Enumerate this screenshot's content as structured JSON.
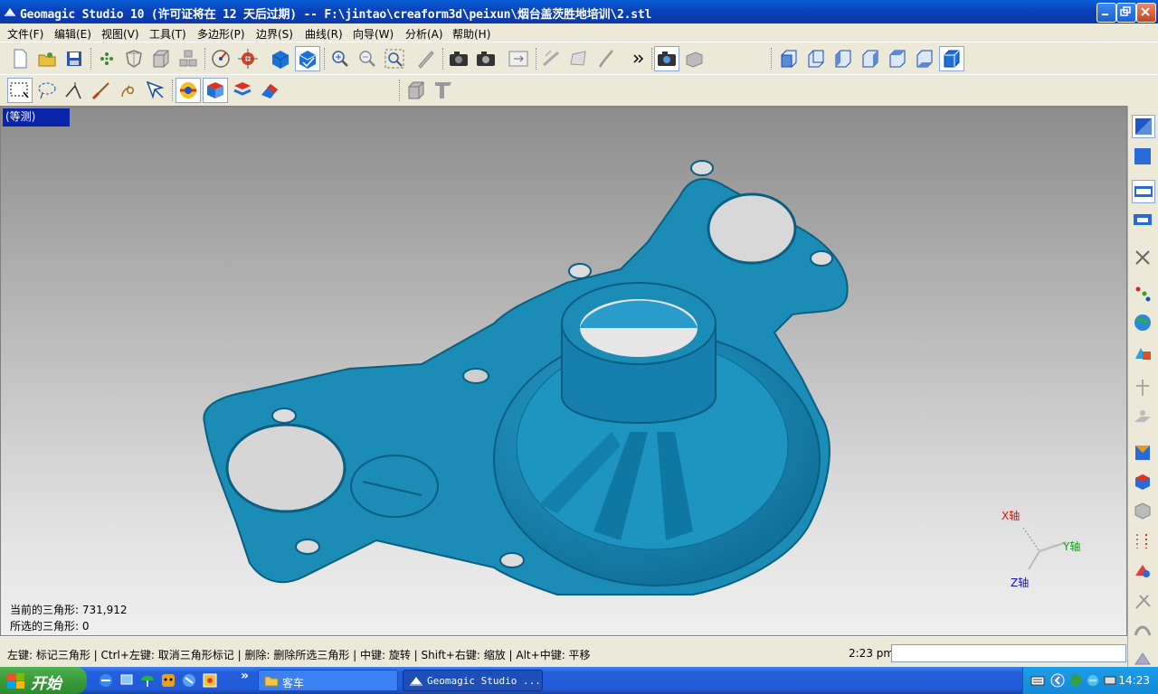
{
  "window": {
    "title": "Geomagic Studio 10 (许可证将在 12 天后过期) -- F:\\jintao\\creaform3d\\peixun\\烟台盖茨胜地培训\\2.stl"
  },
  "menubar": {
    "items": [
      "文件(F)",
      "编辑(E)",
      "视图(V)",
      "工具(T)",
      "多边形(P)",
      "边界(S)",
      "曲线(R)",
      "向导(W)",
      "分析(A)",
      "帮助(H)"
    ]
  },
  "viewport": {
    "view_label": "(等测)",
    "triangle_count_label": "当前的三角形: 731,912",
    "selected_count_label": "所选的三角形: 0",
    "model_color": "#1a8ab4",
    "axes": {
      "x": "X轴",
      "y": "Y轴",
      "z": "Z轴"
    }
  },
  "statusbar": {
    "hint": "左键: 标记三角形 | Ctrl+左键: 取消三角形标记 | 删除: 删除所选三角形 | 中键: 旋转 | Shift+右键: 缩放 | Alt+中键: 平移",
    "time": "2:23 pm"
  },
  "taskbar": {
    "start_label": "开始",
    "chevron": "»",
    "tasks": [
      "客车",
      "Geomagic Studio ..."
    ],
    "clock": "14:23"
  }
}
